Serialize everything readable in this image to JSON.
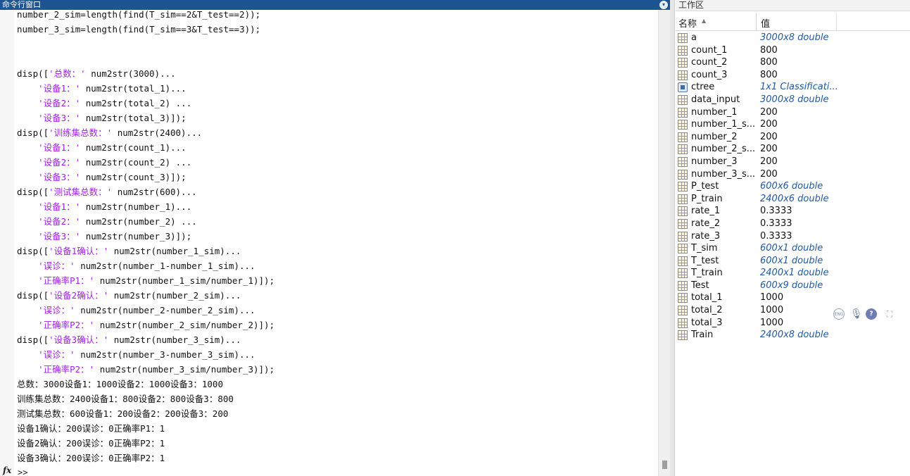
{
  "command_window": {
    "title": "命令行窗口",
    "lines": [
      {
        "kind": "code",
        "segments": [
          {
            "t": "number_2_sim=length(find(T_sim==2&T_test==2));",
            "s": false
          }
        ]
      },
      {
        "kind": "code",
        "segments": [
          {
            "t": "number_3_sim=length(find(T_sim==3&T_test==3));",
            "s": false
          }
        ]
      },
      {
        "kind": "blank"
      },
      {
        "kind": "blank"
      },
      {
        "kind": "code",
        "segments": [
          {
            "t": "disp([",
            "s": false
          },
          {
            "t": "'总数：'",
            "s": true
          },
          {
            "t": " num2str(3000)...",
            "s": false
          }
        ]
      },
      {
        "kind": "code",
        "segments": [
          {
            "t": "    ",
            "s": false
          },
          {
            "t": "'设备1：'",
            "s": true
          },
          {
            "t": " num2str(total_1)...",
            "s": false
          }
        ]
      },
      {
        "kind": "code",
        "segments": [
          {
            "t": "    ",
            "s": false
          },
          {
            "t": "'设备2：'",
            "s": true
          },
          {
            "t": " num2str(total_2) ...",
            "s": false
          }
        ]
      },
      {
        "kind": "code",
        "segments": [
          {
            "t": "    ",
            "s": false
          },
          {
            "t": "'设备3：'",
            "s": true
          },
          {
            "t": " num2str(total_3)]);",
            "s": false
          }
        ]
      },
      {
        "kind": "code",
        "segments": [
          {
            "t": "disp([",
            "s": false
          },
          {
            "t": "'训练集总数：'",
            "s": true
          },
          {
            "t": " num2str(2400)...",
            "s": false
          }
        ]
      },
      {
        "kind": "code",
        "segments": [
          {
            "t": "    ",
            "s": false
          },
          {
            "t": "'设备1：'",
            "s": true
          },
          {
            "t": " num2str(count_1)...",
            "s": false
          }
        ]
      },
      {
        "kind": "code",
        "segments": [
          {
            "t": "    ",
            "s": false
          },
          {
            "t": "'设备2：'",
            "s": true
          },
          {
            "t": " num2str(count_2) ...",
            "s": false
          }
        ]
      },
      {
        "kind": "code",
        "segments": [
          {
            "t": "    ",
            "s": false
          },
          {
            "t": "'设备3：'",
            "s": true
          },
          {
            "t": " num2str(count_3)]);",
            "s": false
          }
        ]
      },
      {
        "kind": "code",
        "segments": [
          {
            "t": "disp([",
            "s": false
          },
          {
            "t": "'测试集总数：'",
            "s": true
          },
          {
            "t": " num2str(600)...",
            "s": false
          }
        ]
      },
      {
        "kind": "code",
        "segments": [
          {
            "t": "    ",
            "s": false
          },
          {
            "t": "'设备1：'",
            "s": true
          },
          {
            "t": " num2str(number_1)...",
            "s": false
          }
        ]
      },
      {
        "kind": "code",
        "segments": [
          {
            "t": "    ",
            "s": false
          },
          {
            "t": "'设备2：'",
            "s": true
          },
          {
            "t": " num2str(number_2) ...",
            "s": false
          }
        ]
      },
      {
        "kind": "code",
        "segments": [
          {
            "t": "    ",
            "s": false
          },
          {
            "t": "'设备3：'",
            "s": true
          },
          {
            "t": " num2str(number_3)]);",
            "s": false
          }
        ]
      },
      {
        "kind": "code",
        "segments": [
          {
            "t": "disp([",
            "s": false
          },
          {
            "t": "'设备1确认：'",
            "s": true
          },
          {
            "t": " num2str(number_1_sim)...",
            "s": false
          }
        ]
      },
      {
        "kind": "code",
        "segments": [
          {
            "t": "    ",
            "s": false
          },
          {
            "t": "'误诊：'",
            "s": true
          },
          {
            "t": " num2str(number_1-number_1_sim)...",
            "s": false
          }
        ]
      },
      {
        "kind": "code",
        "segments": [
          {
            "t": "    ",
            "s": false
          },
          {
            "t": "'正确率P1：'",
            "s": true
          },
          {
            "t": " num2str(number_1_sim/number_1)]);",
            "s": false
          }
        ]
      },
      {
        "kind": "code",
        "segments": [
          {
            "t": "disp([",
            "s": false
          },
          {
            "t": "'设备2确认：'",
            "s": true
          },
          {
            "t": " num2str(number_2_sim)...",
            "s": false
          }
        ]
      },
      {
        "kind": "code",
        "segments": [
          {
            "t": "    ",
            "s": false
          },
          {
            "t": "'误诊：'",
            "s": true
          },
          {
            "t": " num2str(number_2-number_2_sim)...",
            "s": false
          }
        ]
      },
      {
        "kind": "code",
        "segments": [
          {
            "t": "    ",
            "s": false
          },
          {
            "t": "'正确率P2：'",
            "s": true
          },
          {
            "t": " num2str(number_2_sim/number_2)]);",
            "s": false
          }
        ]
      },
      {
        "kind": "code",
        "segments": [
          {
            "t": "disp([",
            "s": false
          },
          {
            "t": "'设备3确认：'",
            "s": true
          },
          {
            "t": " num2str(number_3_sim)...",
            "s": false
          }
        ]
      },
      {
        "kind": "code",
        "segments": [
          {
            "t": "    ",
            "s": false
          },
          {
            "t": "'误诊：'",
            "s": true
          },
          {
            "t": " num2str(number_3-number_3_sim)...",
            "s": false
          }
        ]
      },
      {
        "kind": "code",
        "segments": [
          {
            "t": "    ",
            "s": false
          },
          {
            "t": "'正确率P2：'",
            "s": true
          },
          {
            "t": " num2str(number_3_sim/number_3)]);",
            "s": false
          }
        ]
      },
      {
        "kind": "out",
        "text": "总数：3000设备1：1000设备2：1000设备3：1000"
      },
      {
        "kind": "out",
        "text": "训练集总数：2400设备1：800设备2：800设备3：800"
      },
      {
        "kind": "out",
        "text": "测试集总数：600设备1：200设备2：200设备3：200"
      },
      {
        "kind": "out",
        "text": "设备1确认：200误诊：0正确率P1：1"
      },
      {
        "kind": "out",
        "text": "设备2确认：200误诊：0正确率P2：1"
      },
      {
        "kind": "out",
        "text": "设备3确认：200误诊：0正确率P2：1"
      }
    ],
    "fx_label": "fx",
    "prompt": ">>"
  },
  "workspace": {
    "title": "工作区",
    "col_name": "名称",
    "col_value": "值",
    "sort_icon": "▲",
    "variables": [
      {
        "name": "a",
        "value": "3000x8 double",
        "dim": true,
        "icon": "matrix-icon"
      },
      {
        "name": "count_1",
        "value": "800",
        "dim": false,
        "icon": "matrix-icon"
      },
      {
        "name": "count_2",
        "value": "800",
        "dim": false,
        "icon": "matrix-icon"
      },
      {
        "name": "count_3",
        "value": "800",
        "dim": false,
        "icon": "matrix-icon"
      },
      {
        "name": "ctree",
        "value": "1x1 Classificati...",
        "dim": true,
        "icon": "object-icon"
      },
      {
        "name": "data_input",
        "value": "3000x8 double",
        "dim": true,
        "icon": "matrix-icon"
      },
      {
        "name": "number_1",
        "value": "200",
        "dim": false,
        "icon": "matrix-icon"
      },
      {
        "name": "number_1_s...",
        "value": "200",
        "dim": false,
        "icon": "matrix-icon"
      },
      {
        "name": "number_2",
        "value": "200",
        "dim": false,
        "icon": "matrix-icon"
      },
      {
        "name": "number_2_s...",
        "value": "200",
        "dim": false,
        "icon": "matrix-icon"
      },
      {
        "name": "number_3",
        "value": "200",
        "dim": false,
        "icon": "matrix-icon"
      },
      {
        "name": "number_3_s...",
        "value": "200",
        "dim": false,
        "icon": "matrix-icon"
      },
      {
        "name": "P_test",
        "value": "600x6 double",
        "dim": true,
        "icon": "matrix-icon"
      },
      {
        "name": "P_train",
        "value": "2400x6 double",
        "dim": true,
        "icon": "matrix-icon"
      },
      {
        "name": "rate_1",
        "value": "0.3333",
        "dim": false,
        "icon": "matrix-icon"
      },
      {
        "name": "rate_2",
        "value": "0.3333",
        "dim": false,
        "icon": "matrix-icon"
      },
      {
        "name": "rate_3",
        "value": "0.3333",
        "dim": false,
        "icon": "matrix-icon"
      },
      {
        "name": "T_sim",
        "value": "600x1 double",
        "dim": true,
        "icon": "matrix-icon"
      },
      {
        "name": "T_test",
        "value": "600x1 double",
        "dim": true,
        "icon": "matrix-icon"
      },
      {
        "name": "T_train",
        "value": "2400x1 double",
        "dim": true,
        "icon": "matrix-icon"
      },
      {
        "name": "Test",
        "value": "600x9 double",
        "dim": true,
        "icon": "matrix-icon"
      },
      {
        "name": "total_1",
        "value": "1000",
        "dim": false,
        "icon": "matrix-icon"
      },
      {
        "name": "total_2",
        "value": "1000",
        "dim": false,
        "icon": "matrix-icon"
      },
      {
        "name": "total_3",
        "value": "1000",
        "dim": false,
        "icon": "matrix-icon"
      },
      {
        "name": "Train",
        "value": "2400x8 double",
        "dim": true,
        "icon": "matrix-icon"
      }
    ],
    "tools": {
      "translate": "ENG",
      "mic": "🎙",
      "help": "?",
      "expand": "⛶"
    }
  },
  "colors": {
    "titlebar": "#1c5591",
    "string_literal": "#a020f0",
    "class_value": "#1f5aa6"
  }
}
